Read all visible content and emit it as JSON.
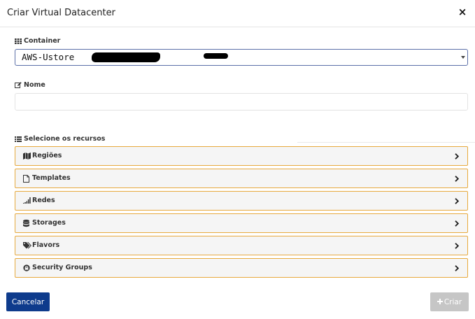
{
  "modal": {
    "title": "Criar Virtual Datacenter",
    "close_symbol": "×"
  },
  "container": {
    "label": "Container",
    "icon": "grid-icon",
    "selected_value": "AWS-Ustore"
  },
  "name": {
    "label": "Nome",
    "icon": "edit-icon",
    "value": "",
    "placeholder": ""
  },
  "resources": {
    "label": "Selecione os recursos",
    "icon": "list-icon",
    "panels": [
      {
        "label": "Regiões",
        "icon": "map-icon"
      },
      {
        "label": "Templates",
        "icon": "file-icon"
      },
      {
        "label": "Redes",
        "icon": "signal-icon"
      },
      {
        "label": "Storages",
        "icon": "database-icon"
      },
      {
        "label": "Flavors",
        "icon": "tags-icon"
      },
      {
        "label": "Security Groups",
        "icon": "shield-icon"
      }
    ]
  },
  "footer": {
    "cancel_label": "Cancelar",
    "create_label": "Criar",
    "create_icon": "plus-icon"
  },
  "colors": {
    "primary_button": "#0e3b8c",
    "disabled_button": "#c6c6c6",
    "panel_border": "#e7a93d",
    "panel_background": "#f5f5f5"
  }
}
